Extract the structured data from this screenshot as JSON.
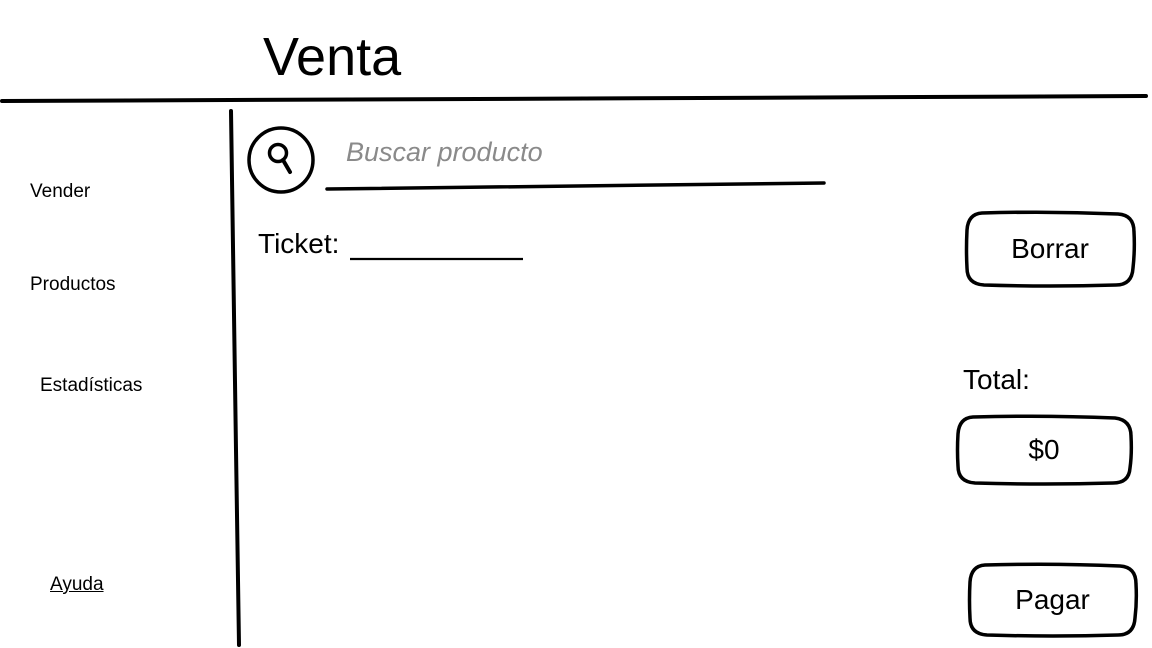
{
  "header": {
    "title": "Venta"
  },
  "sidebar": {
    "items": [
      {
        "label": "Vender"
      },
      {
        "label": "Productos"
      },
      {
        "label": "Estadísticas"
      }
    ],
    "help_link": "Ayuda"
  },
  "search": {
    "icon": "search-icon",
    "placeholder": "Buscar producto",
    "value": ""
  },
  "ticket": {
    "label": "Ticket:",
    "value": ""
  },
  "actions": {
    "clear_label": "Borrar",
    "pay_label": "Pagar"
  },
  "total": {
    "label": "Total:",
    "value": "$0"
  }
}
